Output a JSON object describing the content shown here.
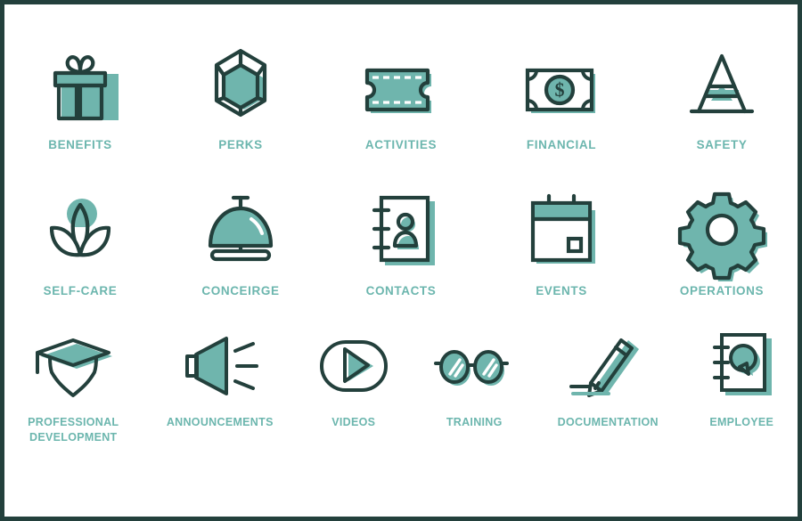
{
  "page": {
    "title": "Employee Benefits Icon Set",
    "background_color": "#ffffff",
    "border_color": "#23403c",
    "stroke_color": "#23403c",
    "fill_color": "#6fb5ad",
    "label_color": "#6cb6ae"
  },
  "rows": [
    {
      "id": "row-1",
      "items": [
        {
          "label": "BENEFITS",
          "icon": "gift-icon"
        },
        {
          "label": "PERKS",
          "icon": "gem-icon"
        },
        {
          "label": "ACTIVITIES",
          "icon": "ticket-icon"
        },
        {
          "label": "FINANCIAL",
          "icon": "dollar-bill-icon"
        },
        {
          "label": "SAFETY",
          "icon": "traffic-cone-icon"
        }
      ]
    },
    {
      "id": "row-2",
      "items": [
        {
          "label": "SELF-CARE",
          "icon": "lotus-flower-icon"
        },
        {
          "label": "CONCEIRGE",
          "icon": "service-bell-icon"
        },
        {
          "label": "CONTACTS",
          "icon": "contact-book-icon"
        },
        {
          "label": "EVENTS",
          "icon": "calendar-icon"
        },
        {
          "label": "OPERATIONS",
          "icon": "gear-icon"
        }
      ]
    },
    {
      "id": "row-3",
      "items": [
        {
          "label": "PROFESSIONAL\nDEVELOPMENT",
          "icon": "graduation-cap-icon"
        },
        {
          "label": "ANNOUNCEMENTS",
          "icon": "megaphone-speaker-icon"
        },
        {
          "label": "VIDEOS",
          "icon": "play-button-icon"
        },
        {
          "label": "TRAINING",
          "icon": "eyeglasses-icon"
        },
        {
          "label": "DOCUMENTATION",
          "icon": "pencil-icon"
        },
        {
          "label": "EMPLOYEE",
          "icon": "notebook-speech-bubble-icon"
        }
      ]
    }
  ]
}
